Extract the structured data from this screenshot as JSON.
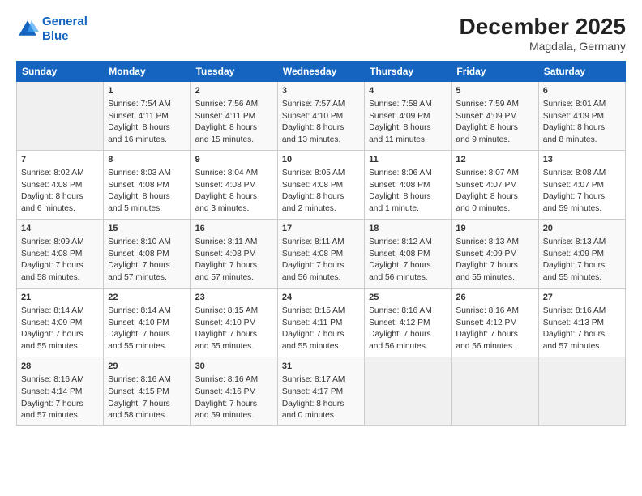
{
  "logo": {
    "line1": "General",
    "line2": "Blue"
  },
  "title": "December 2025",
  "subtitle": "Magdala, Germany",
  "days_of_week": [
    "Sunday",
    "Monday",
    "Tuesday",
    "Wednesday",
    "Thursday",
    "Friday",
    "Saturday"
  ],
  "weeks": [
    [
      {
        "day": "",
        "info": ""
      },
      {
        "day": "1",
        "info": "Sunrise: 7:54 AM\nSunset: 4:11 PM\nDaylight: 8 hours\nand 16 minutes."
      },
      {
        "day": "2",
        "info": "Sunrise: 7:56 AM\nSunset: 4:11 PM\nDaylight: 8 hours\nand 15 minutes."
      },
      {
        "day": "3",
        "info": "Sunrise: 7:57 AM\nSunset: 4:10 PM\nDaylight: 8 hours\nand 13 minutes."
      },
      {
        "day": "4",
        "info": "Sunrise: 7:58 AM\nSunset: 4:09 PM\nDaylight: 8 hours\nand 11 minutes."
      },
      {
        "day": "5",
        "info": "Sunrise: 7:59 AM\nSunset: 4:09 PM\nDaylight: 8 hours\nand 9 minutes."
      },
      {
        "day": "6",
        "info": "Sunrise: 8:01 AM\nSunset: 4:09 PM\nDaylight: 8 hours\nand 8 minutes."
      }
    ],
    [
      {
        "day": "7",
        "info": "Sunrise: 8:02 AM\nSunset: 4:08 PM\nDaylight: 8 hours\nand 6 minutes."
      },
      {
        "day": "8",
        "info": "Sunrise: 8:03 AM\nSunset: 4:08 PM\nDaylight: 8 hours\nand 5 minutes."
      },
      {
        "day": "9",
        "info": "Sunrise: 8:04 AM\nSunset: 4:08 PM\nDaylight: 8 hours\nand 3 minutes."
      },
      {
        "day": "10",
        "info": "Sunrise: 8:05 AM\nSunset: 4:08 PM\nDaylight: 8 hours\nand 2 minutes."
      },
      {
        "day": "11",
        "info": "Sunrise: 8:06 AM\nSunset: 4:08 PM\nDaylight: 8 hours\nand 1 minute."
      },
      {
        "day": "12",
        "info": "Sunrise: 8:07 AM\nSunset: 4:07 PM\nDaylight: 8 hours\nand 0 minutes."
      },
      {
        "day": "13",
        "info": "Sunrise: 8:08 AM\nSunset: 4:07 PM\nDaylight: 7 hours\nand 59 minutes."
      }
    ],
    [
      {
        "day": "14",
        "info": "Sunrise: 8:09 AM\nSunset: 4:08 PM\nDaylight: 7 hours\nand 58 minutes."
      },
      {
        "day": "15",
        "info": "Sunrise: 8:10 AM\nSunset: 4:08 PM\nDaylight: 7 hours\nand 57 minutes."
      },
      {
        "day": "16",
        "info": "Sunrise: 8:11 AM\nSunset: 4:08 PM\nDaylight: 7 hours\nand 57 minutes."
      },
      {
        "day": "17",
        "info": "Sunrise: 8:11 AM\nSunset: 4:08 PM\nDaylight: 7 hours\nand 56 minutes."
      },
      {
        "day": "18",
        "info": "Sunrise: 8:12 AM\nSunset: 4:08 PM\nDaylight: 7 hours\nand 56 minutes."
      },
      {
        "day": "19",
        "info": "Sunrise: 8:13 AM\nSunset: 4:09 PM\nDaylight: 7 hours\nand 55 minutes."
      },
      {
        "day": "20",
        "info": "Sunrise: 8:13 AM\nSunset: 4:09 PM\nDaylight: 7 hours\nand 55 minutes."
      }
    ],
    [
      {
        "day": "21",
        "info": "Sunrise: 8:14 AM\nSunset: 4:09 PM\nDaylight: 7 hours\nand 55 minutes."
      },
      {
        "day": "22",
        "info": "Sunrise: 8:14 AM\nSunset: 4:10 PM\nDaylight: 7 hours\nand 55 minutes."
      },
      {
        "day": "23",
        "info": "Sunrise: 8:15 AM\nSunset: 4:10 PM\nDaylight: 7 hours\nand 55 minutes."
      },
      {
        "day": "24",
        "info": "Sunrise: 8:15 AM\nSunset: 4:11 PM\nDaylight: 7 hours\nand 55 minutes."
      },
      {
        "day": "25",
        "info": "Sunrise: 8:16 AM\nSunset: 4:12 PM\nDaylight: 7 hours\nand 56 minutes."
      },
      {
        "day": "26",
        "info": "Sunrise: 8:16 AM\nSunset: 4:12 PM\nDaylight: 7 hours\nand 56 minutes."
      },
      {
        "day": "27",
        "info": "Sunrise: 8:16 AM\nSunset: 4:13 PM\nDaylight: 7 hours\nand 57 minutes."
      }
    ],
    [
      {
        "day": "28",
        "info": "Sunrise: 8:16 AM\nSunset: 4:14 PM\nDaylight: 7 hours\nand 57 minutes."
      },
      {
        "day": "29",
        "info": "Sunrise: 8:16 AM\nSunset: 4:15 PM\nDaylight: 7 hours\nand 58 minutes."
      },
      {
        "day": "30",
        "info": "Sunrise: 8:16 AM\nSunset: 4:16 PM\nDaylight: 7 hours\nand 59 minutes."
      },
      {
        "day": "31",
        "info": "Sunrise: 8:17 AM\nSunset: 4:17 PM\nDaylight: 8 hours\nand 0 minutes."
      },
      {
        "day": "",
        "info": ""
      },
      {
        "day": "",
        "info": ""
      },
      {
        "day": "",
        "info": ""
      }
    ]
  ]
}
